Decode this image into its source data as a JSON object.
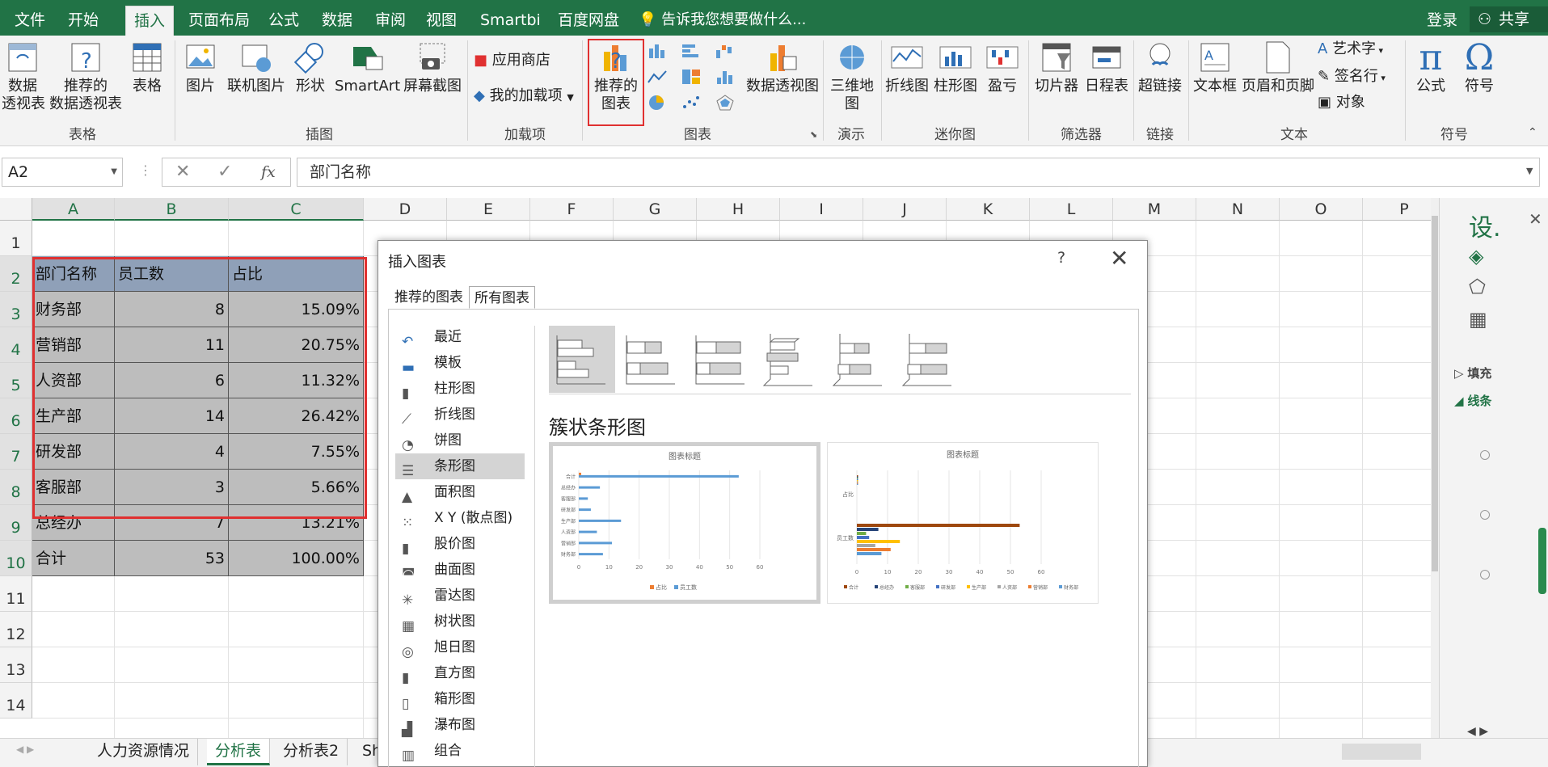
{
  "menubar": {
    "tabs": [
      "文件",
      "开始",
      "插入",
      "页面布局",
      "公式",
      "数据",
      "审阅",
      "视图",
      "Smartbi",
      "百度网盘"
    ],
    "active": "插入",
    "tell_me": "告诉我您想要做什么...",
    "login": "登录",
    "share": "共享"
  },
  "ribbon": {
    "pivot": "数据\n透视表",
    "rec_pivot": "推荐的\n数据透视表",
    "table": "表格",
    "group_table": "表格",
    "picture": "图片",
    "online_picture": "联机图片",
    "shapes": "形状",
    "smartart": "SmartArt",
    "screenshot": "屏幕截图",
    "group_illust": "插图",
    "store": "应用商店",
    "my_addins": "我的加载项",
    "group_addins": "加载项",
    "rec_chart": "推荐的\n图表",
    "pivot_chart": "数据透视图",
    "group_charts": "图表",
    "map3d": "三维地\n图",
    "group_tours": "演示",
    "line": "折线图",
    "column": "柱形图",
    "winloss": "盈亏",
    "group_spark": "迷你图",
    "slicer": "切片器",
    "timeline": "日程表",
    "group_filter": "筛选器",
    "hyperlink": "超链接",
    "group_links": "链接",
    "textbox": "文本框",
    "headerfooter": "页眉和页脚",
    "wordart": "艺术字",
    "signature": "签名行",
    "object": "对象",
    "group_text": "文本",
    "equation": "公式",
    "symbol": "符号",
    "group_symbols": "符号"
  },
  "formula": {
    "namebox": "A2",
    "fx": "fx",
    "content": "部门名称"
  },
  "columns": [
    "A",
    "B",
    "C",
    "D",
    "E",
    "F",
    "G",
    "H",
    "I",
    "J",
    "K",
    "L",
    "M",
    "N",
    "O",
    "P"
  ],
  "rows": [
    "1",
    "2",
    "3",
    "4",
    "5",
    "6",
    "7",
    "8",
    "9",
    "10",
    "11",
    "12",
    "13",
    "14"
  ],
  "table": {
    "headers": [
      "部门名称",
      "员工数",
      "占比"
    ],
    "rows": [
      [
        "财务部",
        "8",
        "15.09%"
      ],
      [
        "营销部",
        "11",
        "20.75%"
      ],
      [
        "人资部",
        "6",
        "11.32%"
      ],
      [
        "生产部",
        "14",
        "26.42%"
      ],
      [
        "研发部",
        "4",
        "7.55%"
      ],
      [
        "客服部",
        "3",
        "5.66%"
      ],
      [
        "总经办",
        "7",
        "13.21%"
      ],
      [
        "合计",
        "53",
        "100.00%"
      ]
    ]
  },
  "sheets": [
    "人力资源情况",
    "分析表",
    "分析表2",
    "Sh"
  ],
  "active_sheet": "分析表",
  "pane": {
    "title": "设.",
    "item1": "填充",
    "item2": "线条"
  },
  "dialog": {
    "title": "插入图表",
    "help": "?",
    "close": "✕",
    "tabs": [
      "推荐的图表",
      "所有图表"
    ],
    "active_tab": "所有图表",
    "categories": [
      "最近",
      "模板",
      "柱形图",
      "折线图",
      "饼图",
      "条形图",
      "面积图",
      "X Y (散点图)",
      "股价图",
      "曲面图",
      "雷达图",
      "树状图",
      "旭日图",
      "直方图",
      "箱形图",
      "瀑布图",
      "组合"
    ],
    "active_category": "条形图",
    "subtype_name": "簇状条形图",
    "preview1": {
      "title": "图表标题",
      "cats": [
        "合计",
        "总经办",
        "客服部",
        "研发部",
        "生产部",
        "人资部",
        "营销部",
        "财务部"
      ],
      "values": [
        53,
        7,
        3,
        4,
        14,
        6,
        11,
        8
      ],
      "ticks": [
        "0",
        "10",
        "20",
        "30",
        "40",
        "50",
        "60"
      ],
      "legend": [
        "占比",
        "员工数"
      ]
    },
    "preview2": {
      "title": "图表标题",
      "cats": [
        "占比",
        "员工数"
      ],
      "ticks": [
        "0",
        "10",
        "20",
        "30",
        "40",
        "50",
        "60"
      ],
      "legend": [
        "合计",
        "总经办",
        "客服部",
        "研发部",
        "生产部",
        "人资部",
        "营销部",
        "财务部"
      ]
    }
  },
  "colors": {
    "brand": "#217346",
    "highlight": "#e03030",
    "bar_blue": "#5b9bd5",
    "bar_orange": "#ed7d31"
  }
}
